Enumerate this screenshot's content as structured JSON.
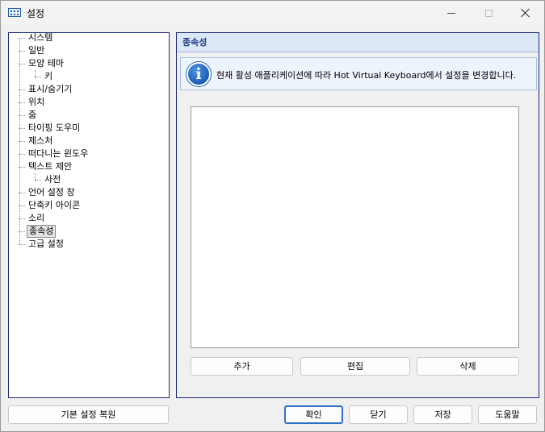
{
  "window": {
    "title": "설정"
  },
  "tree": {
    "items": [
      {
        "label": "시스템"
      },
      {
        "label": "일반"
      },
      {
        "label": "모양 테마"
      },
      {
        "label": "키"
      },
      {
        "label": "표시/숨기기"
      },
      {
        "label": "위치"
      },
      {
        "label": "줌"
      },
      {
        "label": "타이핑 도우미"
      },
      {
        "label": "제스처"
      },
      {
        "label": "떠다니는 윈도우"
      },
      {
        "label": "텍스트 제안"
      },
      {
        "label": "사전"
      },
      {
        "label": "언어 설정 창"
      },
      {
        "label": "단축키 아이콘"
      },
      {
        "label": "소리"
      },
      {
        "label": "종속성"
      },
      {
        "label": "고급 설정"
      }
    ],
    "selected": "종속성"
  },
  "panel": {
    "header": "종속성",
    "info_text": "현재 활성 애플리케이션에 따라 Hot Virtual Keyboard에서 설정을 변경합니다.",
    "buttons": {
      "add": "추가",
      "edit": "편집",
      "delete": "삭제"
    }
  },
  "footer": {
    "restore": "기본 설정 복원",
    "ok": "확인",
    "close": "닫기",
    "save": "저장",
    "help": "도움말"
  },
  "icons": [
    "keyboard-icon",
    "minimize-icon",
    "maximize-icon",
    "close-icon",
    "info-icon"
  ],
  "colors": {
    "accent": "#2f6fc6",
    "panel_border": "#1e2a78",
    "header_bg": "#dce8f8",
    "header_text": "#1b3a80"
  }
}
